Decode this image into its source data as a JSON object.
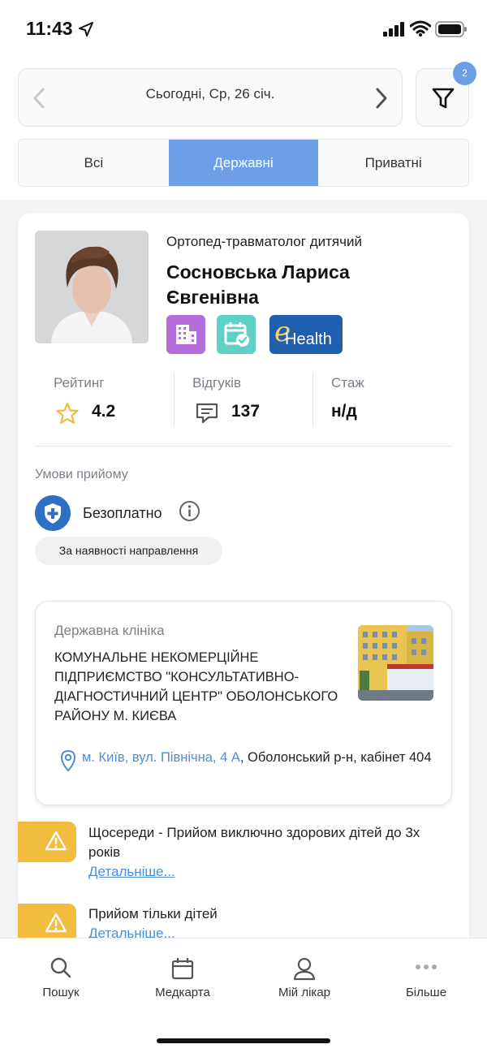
{
  "status_bar": {
    "time": "11:43"
  },
  "date_nav": {
    "date_label": "Сьогодні, Ср, 26 січ."
  },
  "filter": {
    "badge_count": "2"
  },
  "tabs": [
    {
      "label": "Всі",
      "active": false
    },
    {
      "label": "Державні",
      "active": true
    },
    {
      "label": "Приватні",
      "active": false
    }
  ],
  "doctor": {
    "specialty": "Ортопед-травматолог дитячий",
    "name": "Сосновська Лариса Євгенівна",
    "badges": [
      "clinic-icon",
      "calendar-check-icon",
      "ehealth-logo"
    ],
    "ehealth_logo": {
      "e": "e",
      "text": "Health"
    },
    "rating_label": "Рейтинг",
    "rating_value": "4.2",
    "reviews_label": "Відгуків",
    "reviews_value": "137",
    "experience_label": "Стаж",
    "experience_value": "н/д"
  },
  "conditions": {
    "label": "Умови прийому",
    "price": "Безоплатно",
    "referral_note": "За наявності направлення"
  },
  "clinic": {
    "type": "Державна клініка",
    "name": "КОМУНАЛЬНЕ НЕКОМЕРЦІЙНЕ ПІДПРИЄМСТВО \"КОНСУЛЬТАТИВНО-ДІАГНОСТИЧНИЙ ЦЕНТР\" ОБОЛОНСЬКОГО РАЙОНУ М. КИЄВА",
    "address_link": "м. Київ, вул. Північна, 4 А",
    "address_rest": ", Оболонський р-н, кабінет 404"
  },
  "notices": [
    {
      "text": "Щосереди - Прийом виключно здорових дітей до 3х років",
      "more": "Детальніше..."
    },
    {
      "text": "Прийом тільки дітей",
      "more": "Детальніше..."
    }
  ],
  "bottom_nav": [
    {
      "label": "Пошук",
      "icon": "search-icon"
    },
    {
      "label": "Медкарта",
      "icon": "calendar-icon"
    },
    {
      "label": "Мій лікар",
      "icon": "user-icon"
    },
    {
      "label": "Більше",
      "icon": "more-icon"
    }
  ],
  "colors": {
    "accent": "#6c9ee6",
    "link": "#4a8fd8",
    "warning": "#f2bc3f",
    "shield": "#2f6fc4",
    "star": "#f2bc3f"
  }
}
